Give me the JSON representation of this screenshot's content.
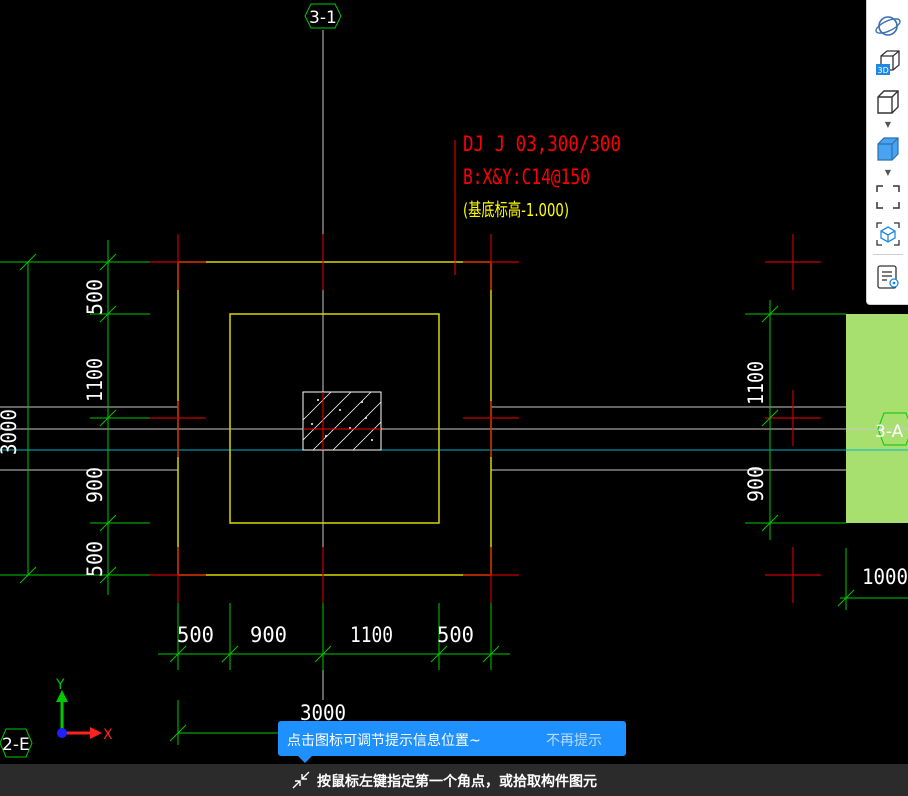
{
  "canvas": {
    "colors": {
      "background": "#000000",
      "grid_axis": "#c8c8c8",
      "dimension": "#00c800",
      "footing_outline": "#d8d800",
      "column_hatch": "#ffffff",
      "cross_marks": "#c80000",
      "annotation": "#ff0000",
      "annotation_yellow": "#ffff00",
      "cyan_axis": "#00b4c8",
      "selected_member": "#a8e070"
    },
    "axis_labels": {
      "top": "3-1",
      "right": "3-A",
      "bottom_left": "2-E",
      "left_partial": "3000"
    },
    "annotation": {
      "line1": "DJ J 03,300/300",
      "line2": "B:X&Y:C14@150",
      "line3": "(基底标高-1.000)"
    },
    "dimensions": {
      "left_vertical": [
        "500",
        "1100",
        "900",
        "500"
      ],
      "right_vertical": [
        "1100",
        "900"
      ],
      "bottom_horizontal": [
        "500",
        "900",
        "1100",
        "500"
      ],
      "bottom_total": "3000",
      "right_partial": "1000"
    },
    "ucs": {
      "x_label": "X",
      "y_label": "Y"
    }
  },
  "toolbar": {
    "icons": [
      "orbit-icon",
      "view-3d-icon",
      "cube-view-icon",
      "cube-shaded-icon",
      "fit-window-icon",
      "component-view-icon",
      "properties-icon"
    ]
  },
  "tooltip": {
    "message": "点击图标可调节提示信息位置~",
    "dismiss_label": "不再提示"
  },
  "status_bar": {
    "prompt": "按鼠标左键指定第一个角点，或拾取构件图元"
  }
}
